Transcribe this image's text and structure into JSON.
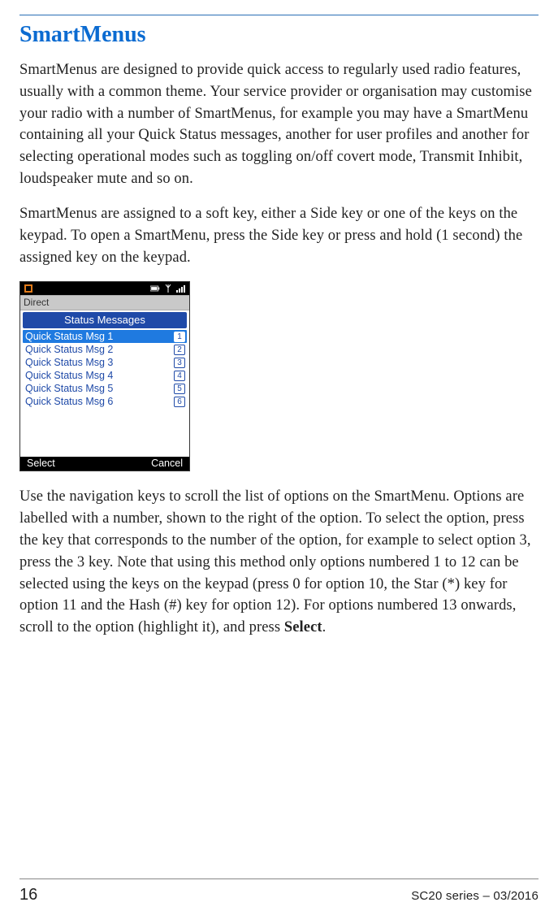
{
  "heading": "SmartMenus",
  "para1": "SmartMenus are designed to provide quick access to regularly used radio features, usually with a common theme. Your service provider or organisation may customise your radio with a number of SmartMenus, for example you may have a SmartMenu containing all your Quick Status messages, another for user profiles and another for selecting operational modes such as toggling on/off covert mode, Transmit Inhibit, loudspeaker mute and so on.",
  "para2": "SmartMenus are assigned to a soft key, either a Side key or one of the keys on the keypad. To open a SmartMenu, press the Side key or press and hold (1 second) the assigned key on the keypad.",
  "para3_pre": "Use the navigation keys to scroll the list of options on the SmartMenu. Options are labelled with a number, shown to the right of the option. To select the option, press the key that corresponds to the number of the option, for example to select option 3, press the 3 key. Note that using this method only options numbered 1 to 12 can be selected using the keys on the keypad (press 0 for option 10, the Star (*) key for option 11 and the Hash (#) key for option 12). For options numbered 13 onwards, scroll to the option (highlight it), and press ",
  "para3_bold": "Select",
  "para3_post": ".",
  "radio": {
    "mode_label": "Direct",
    "menu_title": "Status Messages",
    "items": [
      {
        "label": "Quick Status Msg 1",
        "num": "1",
        "selected": true
      },
      {
        "label": "Quick Status Msg 2",
        "num": "2",
        "selected": false
      },
      {
        "label": "Quick Status Msg 3",
        "num": "3",
        "selected": false
      },
      {
        "label": "Quick Status Msg 4",
        "num": "4",
        "selected": false
      },
      {
        "label": "Quick Status Msg 5",
        "num": "5",
        "selected": false
      },
      {
        "label": "Quick Status Msg 6",
        "num": "6",
        "selected": false
      }
    ],
    "softkeys": {
      "left": "Select",
      "right": "Cancel"
    },
    "status_icons": [
      "direct-mode-icon",
      "battery-icon",
      "antenna-icon",
      "signal-icon"
    ]
  },
  "footer": {
    "page_number": "16",
    "doc_id": "SC20 series – 03/2016"
  }
}
